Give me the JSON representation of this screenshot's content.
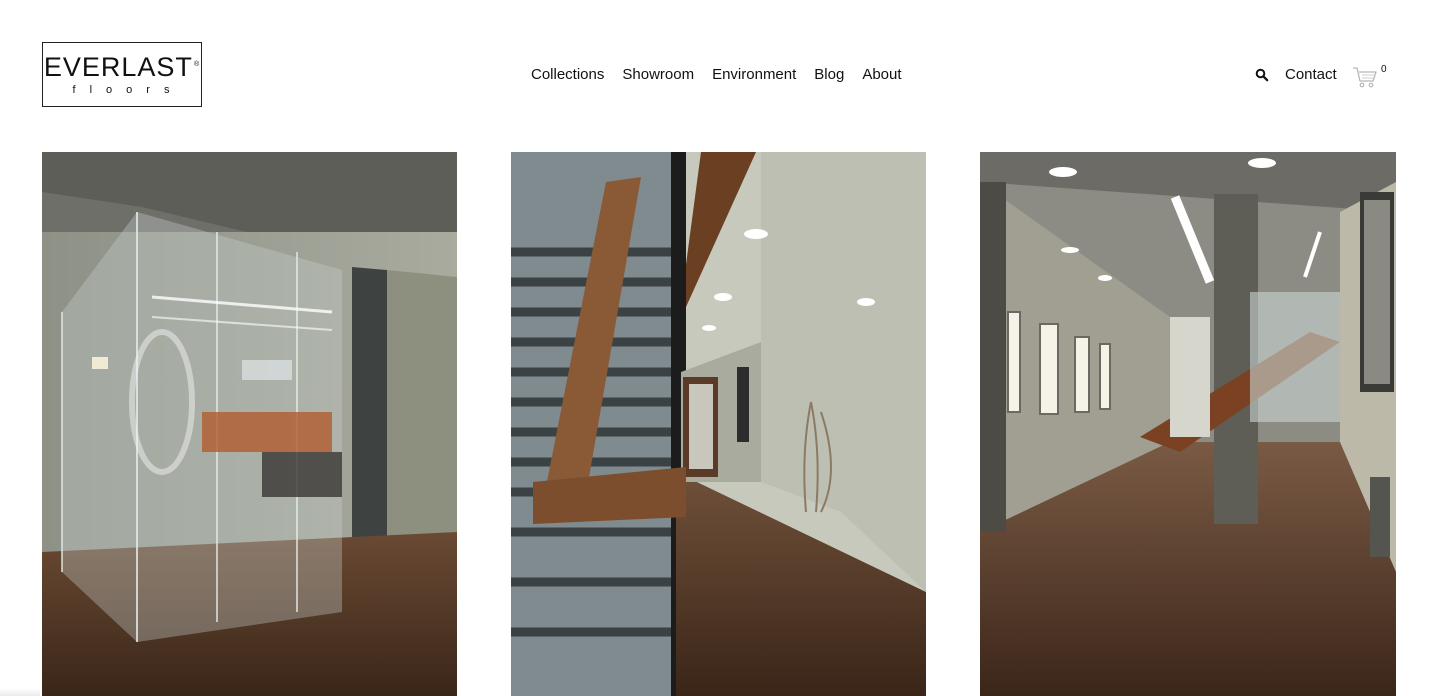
{
  "brand": {
    "name": "EVERLAST",
    "registered_mark": "®",
    "tagline": "floors"
  },
  "nav": {
    "items": [
      {
        "label": "Collections"
      },
      {
        "label": "Showroom"
      },
      {
        "label": "Environment"
      },
      {
        "label": "Blog"
      },
      {
        "label": "About"
      }
    ]
  },
  "utility": {
    "search_icon": "search-icon",
    "contact_label": "Contact",
    "cart_icon": "cart-icon",
    "cart_count": "0"
  },
  "gallery": {
    "images": [
      {
        "subject": "glass-walled-office-with-dark-wood-floor"
      },
      {
        "subject": "staircase-wood-handrail-and-corridor"
      },
      {
        "subject": "lobby-hallway-with-column-and-staircase"
      }
    ]
  },
  "colors": {
    "text": "#111111",
    "background": "#ffffff",
    "wood_floor": "#4a3222",
    "wall": "#b7b9ae",
    "handrail": "#8a5a36"
  }
}
